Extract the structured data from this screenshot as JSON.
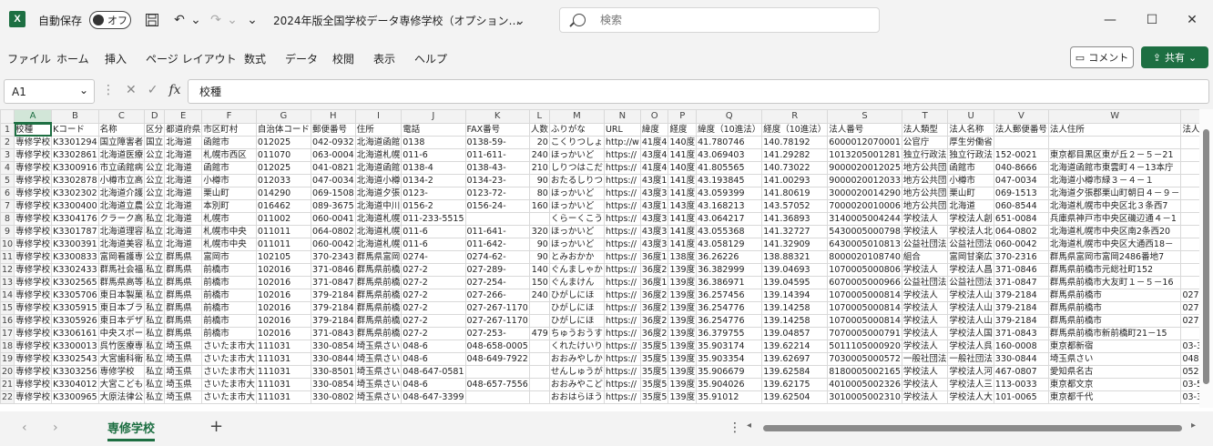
{
  "titlebar": {
    "logo": "X",
    "autosave_label": "自動保存",
    "toggle_state": "オフ",
    "doc_title": "2024年版全国学校データ専修学校（オプション…",
    "search_placeholder": "検索"
  },
  "menu": {
    "items": [
      "ファイル",
      "ホーム",
      "挿入",
      "ページ レイアウト",
      "数式",
      "データ",
      "校閲",
      "表示",
      "ヘルプ"
    ],
    "comment_label": "コメント",
    "share_label": "共有"
  },
  "formula_bar": {
    "name_box": "A1",
    "fx_label": "fx",
    "formula_value": "校種"
  },
  "sheet": {
    "columns": [
      "A",
      "B",
      "C",
      "D",
      "E",
      "F",
      "G",
      "H",
      "I",
      "J",
      "K",
      "L",
      "M",
      "N",
      "O",
      "P",
      "Q",
      "R",
      "S",
      "T",
      "U",
      "V",
      "W",
      "X",
      "Y"
    ],
    "rows": [
      [
        "校種",
        "Kコード",
        "名称",
        "区分",
        "都道府県",
        "市区町村",
        "自治体コード",
        "郵便番号",
        "住所",
        "電話",
        "FAX番号",
        "人数",
        "ふりがな",
        "URL",
        "緯度",
        "経度",
        "緯度（10進法）",
        "経度（10進法）",
        "法人番号",
        "法人類型",
        "法人名称",
        "法人郵便番号",
        "法人住所",
        "法人電話番号",
        "法人FAX番号"
      ],
      [
        "専修学校",
        "K3301294",
        "国立障害者",
        "国立",
        "北海道",
        "函館市",
        "012025",
        "042-0932",
        "北海道函館",
        "0138",
        "0138-59-",
        "20",
        "こくりつしょ",
        "http://w",
        "41度4",
        "140度",
        "41.780746",
        "140.78192",
        "6000012070001",
        "公官庁",
        "厚生労働省",
        "",
        "",
        "",
        ""
      ],
      [
        "専修学校",
        "K3302861",
        "北海道医療",
        "公立",
        "北海道",
        "札幌市西区",
        "011070",
        "063-0004",
        "北海道札幌",
        "011-6",
        "011-611-",
        "240",
        "ほっかいど",
        "https://",
        "43度4",
        "141度",
        "43.069403",
        "141.29282",
        "1013205001281",
        "独立行政法",
        "独立行政法",
        "152-0021",
        "東京都目黒区東が丘２－５－21",
        "",
        ""
      ],
      [
        "専修学校",
        "K3300916",
        "市立函館病",
        "公立",
        "北海道",
        "函館市",
        "012025",
        "041-0821",
        "北海道函館",
        "0138-4",
        "0138-43-",
        "210",
        "しりつはこだ",
        "https://",
        "41度4",
        "140度",
        "41.805565",
        "140.73022",
        "9000020012025",
        "地方公共団",
        "函館市",
        "040-8666",
        "北海道函館市東雲町４－13本庁",
        "",
        ""
      ],
      [
        "専修学校",
        "K3302878",
        "小樽市立高",
        "公立",
        "北海道",
        "小樽市",
        "012033",
        "047-0034",
        "北海道小樽",
        "0134-2",
        "0134-23-",
        "90",
        "おたるしりつ",
        "https://",
        "43度1",
        "141度",
        "43.193845",
        "141.00293",
        "9000020012033",
        "地方公共団",
        "小樽市",
        "047-0034",
        "北海道小樽市緑３－４－１",
        "",
        ""
      ],
      [
        "専修学校",
        "K3302302",
        "北海道介護",
        "公立",
        "北海道",
        "栗山町",
        "014290",
        "069-1508",
        "北海道夕張",
        "0123-",
        "0123-72-",
        "80",
        "ほっかいど",
        "https://",
        "43度3",
        "141度",
        "43.059399",
        "141.80619",
        "3000020014290",
        "地方公共団",
        "栗山町",
        "069-1513",
        "北海道夕張郡栗山町朝日４－９－",
        "",
        ""
      ],
      [
        "専修学校",
        "K3300400",
        "北海道立農",
        "公立",
        "北海道",
        "本別町",
        "016462",
        "089-3675",
        "北海道中川",
        "0156-2",
        "0156-24-",
        "160",
        "ほっかいど",
        "https://",
        "43度1",
        "143度",
        "43.168213",
        "143.57052",
        "7000020010006",
        "地方公共団",
        "北海道",
        "060-8544",
        "北海道札幌市中央区北３条西7",
        "",
        ""
      ],
      [
        "専修学校",
        "K3304176",
        "クラーク高",
        "私立",
        "北海道",
        "札幌市",
        "011002",
        "060-0041",
        "北海道札幌",
        "011-233-5515",
        "",
        "",
        "くらーくこう",
        "https://",
        "43度3",
        "141度",
        "43.064217",
        "141.36893",
        "3140005004244",
        "学校法人",
        "学校法人創",
        "651-0084",
        "兵庫県神戸市中央区磯辺通４－1",
        "",
        ""
      ],
      [
        "専修学校",
        "K3301787",
        "北海道理容",
        "私立",
        "北海道",
        "札幌市中央",
        "011011",
        "064-0802",
        "北海道札幌",
        "011-6",
        "011-641-",
        "320",
        "ほっかいど",
        "https://",
        "43度3",
        "141度",
        "43.055368",
        "141.32727",
        "5430005000798",
        "学校法人",
        "学校法人北",
        "064-0802",
        "北海道札幌市中央区南2条西20",
        "",
        ""
      ],
      [
        "専修学校",
        "K3300391",
        "北海道美容",
        "私立",
        "北海道",
        "札幌市中央",
        "011011",
        "060-0042",
        "北海道札幌",
        "011-6",
        "011-642-",
        "90",
        "ほっかいど",
        "https://",
        "43度3",
        "141度",
        "43.058129",
        "141.32909",
        "6430005010813",
        "公益社団法",
        "公益社団法",
        "060-0042",
        "北海道札幌市中央区大通西18－",
        "",
        ""
      ],
      [
        "専修学校",
        "K3300833",
        "富岡看護専",
        "公立",
        "群馬県",
        "富岡市",
        "102105",
        "370-2343",
        "群馬県富岡",
        "0274-",
        "0274-62-",
        "90",
        "とみおかか",
        "https://",
        "36度1",
        "138度",
        "36.26226",
        "138.88321",
        "8000020108740",
        "組合",
        "富岡甘楽広",
        "370-2316",
        "群馬県富岡市富岡2486番地7",
        "",
        ""
      ],
      [
        "専修学校",
        "K3302433",
        "群馬社会福",
        "私立",
        "群馬県",
        "前橋市",
        "102016",
        "371-0846",
        "群馬県前橋",
        "027-2",
        "027-289-",
        "140",
        "ぐんましゃか",
        "https://",
        "36度2",
        "139度",
        "36.382999",
        "139.04693",
        "1070005000806",
        "学校法人",
        "学校法人昌",
        "371-0846",
        "群馬県前橋市元総社町152",
        "",
        ""
      ],
      [
        "専修学校",
        "K3302565",
        "群馬県高等",
        "私立",
        "群馬県",
        "前橋市",
        "102016",
        "371-0847",
        "群馬県前橋",
        "027-2",
        "027-254-",
        "150",
        "ぐんまけん",
        "https://",
        "36度1",
        "139度",
        "36.386971",
        "139.04595",
        "6070005000966",
        "公益社団法",
        "公益社団法",
        "371-0847",
        "群馬県前橋市大友町１－５－16",
        "",
        ""
      ],
      [
        "専修学校",
        "K3305706",
        "東日本製菓",
        "私立",
        "群馬県",
        "前橋市",
        "102016",
        "379-2184",
        "群馬県前橋",
        "027-2",
        "027-266-",
        "240",
        "ひがしにほ",
        "https://",
        "36度2",
        "139度",
        "36.257456",
        "139.14394",
        "1070005000814",
        "学校法人",
        "学校法人山",
        "379-2184",
        "群馬県前橋市",
        "027-266-7977",
        ""
      ],
      [
        "専修学校",
        "K3305915",
        "東日本ブラ",
        "私立",
        "群馬県",
        "前橋市",
        "102016",
        "379-2184",
        "群馬県前橋",
        "027-2",
        "027-267-1170",
        "",
        "ひがしにほ",
        "https://",
        "36度2",
        "139度",
        "36.254776",
        "139.14258",
        "1070005000814",
        "学校法人",
        "学校法人山",
        "379-2184",
        "群馬県前橋市",
        "027-266-7977",
        ""
      ],
      [
        "専修学校",
        "K3305926",
        "東日本デザ",
        "私立",
        "群馬県",
        "前橋市",
        "102016",
        "379-2184",
        "群馬県前橋",
        "027-2",
        "027-267-1170",
        "",
        "ひがしにほ",
        "https://",
        "36度2",
        "139度",
        "36.254776",
        "139.14258",
        "1070005000814",
        "学校法人",
        "学校法人山",
        "379-2184",
        "群馬県前橋市",
        "027-266-7977",
        ""
      ],
      [
        "専修学校",
        "K3306161",
        "中央スポー",
        "私立",
        "群馬県",
        "前橋市",
        "102016",
        "371-0843",
        "群馬県前橋",
        "027-2",
        "027-253-",
        "479",
        "ちゅうおうす",
        "https://",
        "36度2",
        "139度",
        "36.379755",
        "139.04857",
        "7070005000791",
        "学校法人",
        "学校法人国",
        "371-0843",
        "群馬県前橋市新前橋町21－15",
        "",
        ""
      ],
      [
        "専修学校",
        "K3300013",
        "呉竹医療専",
        "私立",
        "埼玉県",
        "さいたま市大",
        "111031",
        "330-0854",
        "埼玉県さい",
        "048-6",
        "048-658-0005",
        "",
        "くれたけいり",
        "https://",
        "35度5",
        "139度",
        "35.903174",
        "139.62214",
        "5011105000920",
        "学校法人",
        "学校法人呉",
        "160-0008",
        "東京都新宿",
        "03-3341-4043",
        ""
      ],
      [
        "専修学校",
        "K3302543",
        "大宮歯科衛",
        "私立",
        "埼玉県",
        "さいたま市大",
        "111031",
        "330-0844",
        "埼玉県さい",
        "048-6",
        "048-649-7922",
        "",
        "おおみやしか",
        "https://",
        "35度5",
        "139度",
        "35.903354",
        "139.62697",
        "7030005000572",
        "一般社団法",
        "一般社団法",
        "330-0844",
        "埼玉県さい",
        "048-644-8324",
        ""
      ],
      [
        "専修学校",
        "K3303256",
        "専修学校",
        "私立",
        "埼玉県",
        "さいたま市大",
        "111031",
        "330-8501",
        "埼玉県さい",
        "048-647-0581",
        "",
        "",
        "せんしゅうが",
        "https://",
        "35度5",
        "139度",
        "35.906679",
        "139.62584",
        "8180005002165",
        "学校法人",
        "学校法人河",
        "467-0807",
        "愛知県名古",
        "052-735-1613",
        ""
      ],
      [
        "専修学校",
        "K3304012",
        "大宮こども",
        "私立",
        "埼玉県",
        "さいたま市大",
        "111031",
        "330-0854",
        "埼玉県さい",
        "048-6",
        "048-657-7556",
        "",
        "おおみやこど",
        "https://",
        "35度5",
        "139度",
        "35.904026",
        "139.62175",
        "4010005002326",
        "学校法人",
        "学校法人三",
        "113-0033",
        "東京都文京",
        "03-5805-1535",
        ""
      ],
      [
        "専修学校",
        "K3300965",
        "大原法律公",
        "私立",
        "埼玉県",
        "さいたま市大",
        "111031",
        "330-0802",
        "埼玉県さい",
        "048-647-3399",
        "",
        "",
        "おおはらほう",
        "https://",
        "35度5",
        "139度",
        "35.91012",
        "139.62504",
        "3010005002310",
        "学校法人",
        "学校法人大",
        "101-0065",
        "東京都千代",
        "03-3292-6266",
        ""
      ]
    ]
  },
  "sheetbar": {
    "tab_label": "専修学校",
    "add_label": "+"
  }
}
